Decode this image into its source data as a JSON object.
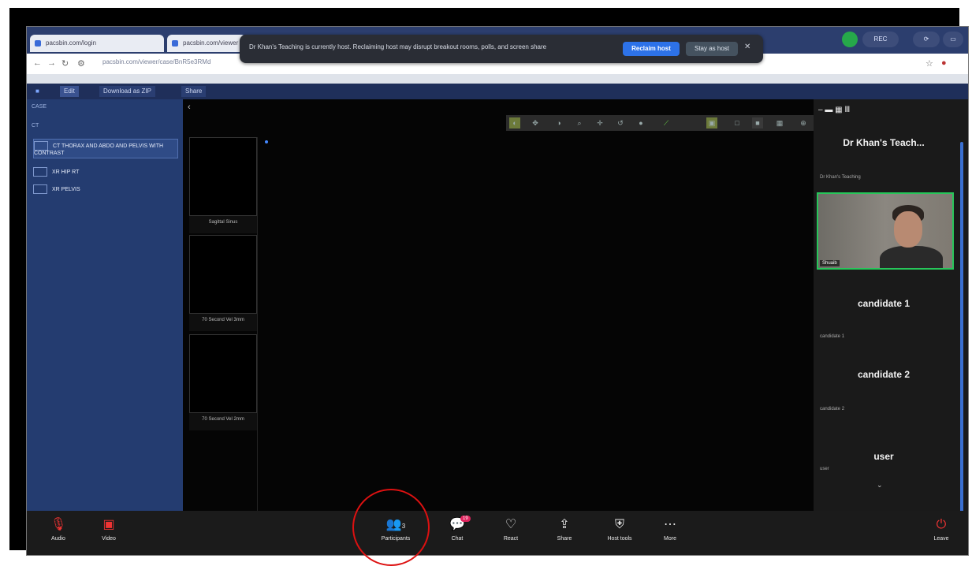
{
  "browser": {
    "tab1": "pacsbin.com/login",
    "tab2": "pacsbin.com/viewer",
    "url": "pacsbin.com/viewer/case/BnR5e3RMd"
  },
  "banner": {
    "message": "Dr Khan's Teaching is currently host. Reclaiming host may disrupt breakout rooms, polls, and screen share",
    "reclaim": "Reclaim host",
    "stay": "Stay as host"
  },
  "record_pill": "REC",
  "app": {
    "edit": "Edit",
    "download": "Download as ZIP",
    "share": "Share"
  },
  "sidebar": {
    "case_label": "CASE",
    "ct_label": "CT",
    "series": [
      "CT THORAX AND ABDO AND PELVIS WITH CONTRAST",
      "XR HIP RT",
      "XR PELVIS"
    ]
  },
  "thumbs": [
    "Sagittal Sinus",
    "70 Second Vel 3mm",
    "70 Second Vel 2mm"
  ],
  "panel": {
    "host_name": "Dr Khan's Teach...",
    "host_sub": "Dr Khan's Teaching",
    "video_name": "Shuaib",
    "c1": "candidate 1",
    "c1_sub": "candidate 1",
    "c2": "candidate 2",
    "c2_sub": "candidate 2",
    "u": "user",
    "u_sub": "user"
  },
  "meeting": {
    "audio": "Audio",
    "video": "Video",
    "participants": "Participants",
    "participants_count": "3",
    "chat": "Chat",
    "chat_badge": "19",
    "react": "React",
    "share": "Share",
    "host_tools": "Host tools",
    "more": "More",
    "leave": "Leave"
  },
  "colors": {
    "accent": "#2d72e8",
    "sidebar": "#243c70",
    "highlight_circle": "#dd1111",
    "speaker_border": "#27c65a"
  }
}
